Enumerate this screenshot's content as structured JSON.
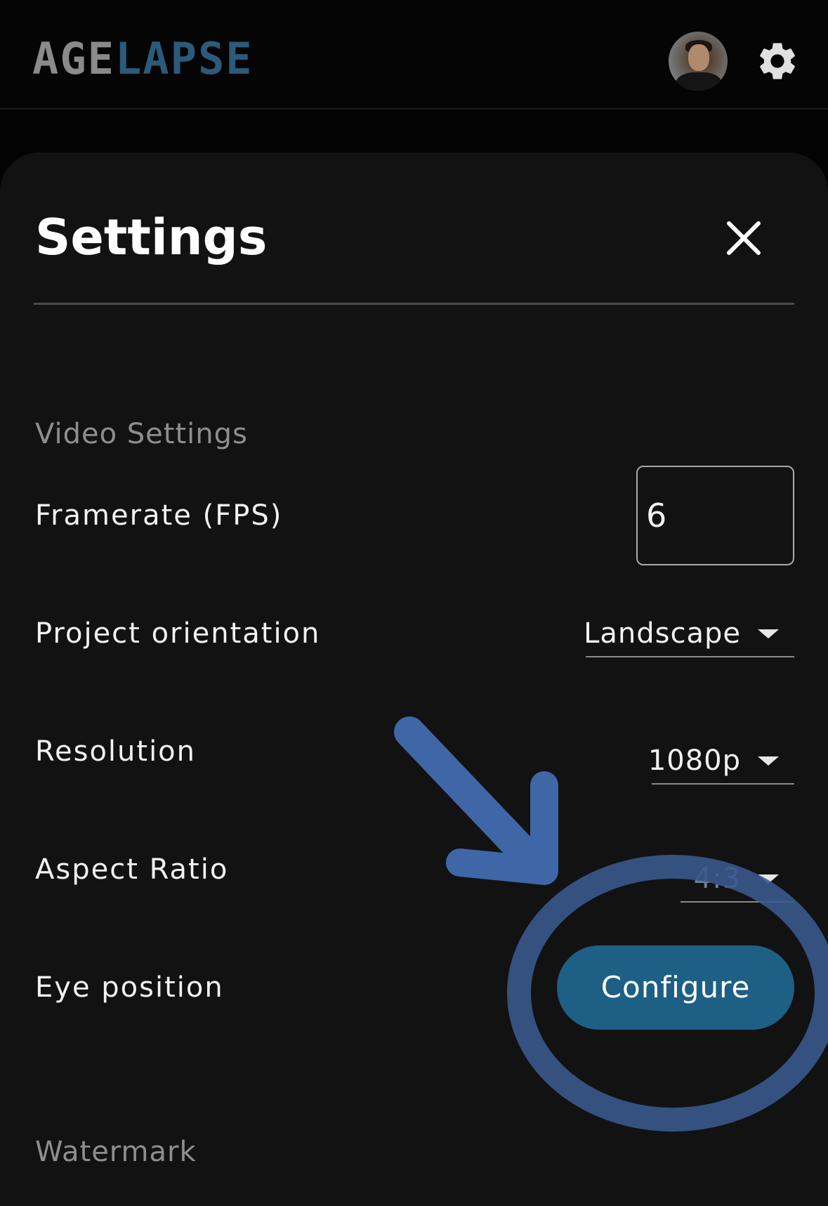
{
  "header": {
    "logo_part1": "AGE",
    "logo_part2": "LAPSE"
  },
  "sheet": {
    "title": "Settings"
  },
  "video_settings": {
    "section_label": "Video Settings",
    "framerate": {
      "label": "Framerate (FPS)",
      "value": "6"
    },
    "orientation": {
      "label": "Project orientation",
      "value": "Landscape"
    },
    "resolution": {
      "label": "Resolution",
      "value": "1080p"
    },
    "aspect_ratio": {
      "label": "Aspect Ratio",
      "value": "4:3"
    },
    "eye_position": {
      "label": "Eye position",
      "button_label": "Configure"
    }
  },
  "watermark": {
    "section_label": "Watermark"
  },
  "colors": {
    "accent_button": "#1e5f85",
    "annotation_blue": "#3f67a8",
    "logo_grey": "#8a8a8a",
    "logo_blue": "#2c5a7a"
  },
  "icons": {
    "settings": "gear-icon",
    "close": "close-icon",
    "dropdown": "caret-down-icon"
  }
}
